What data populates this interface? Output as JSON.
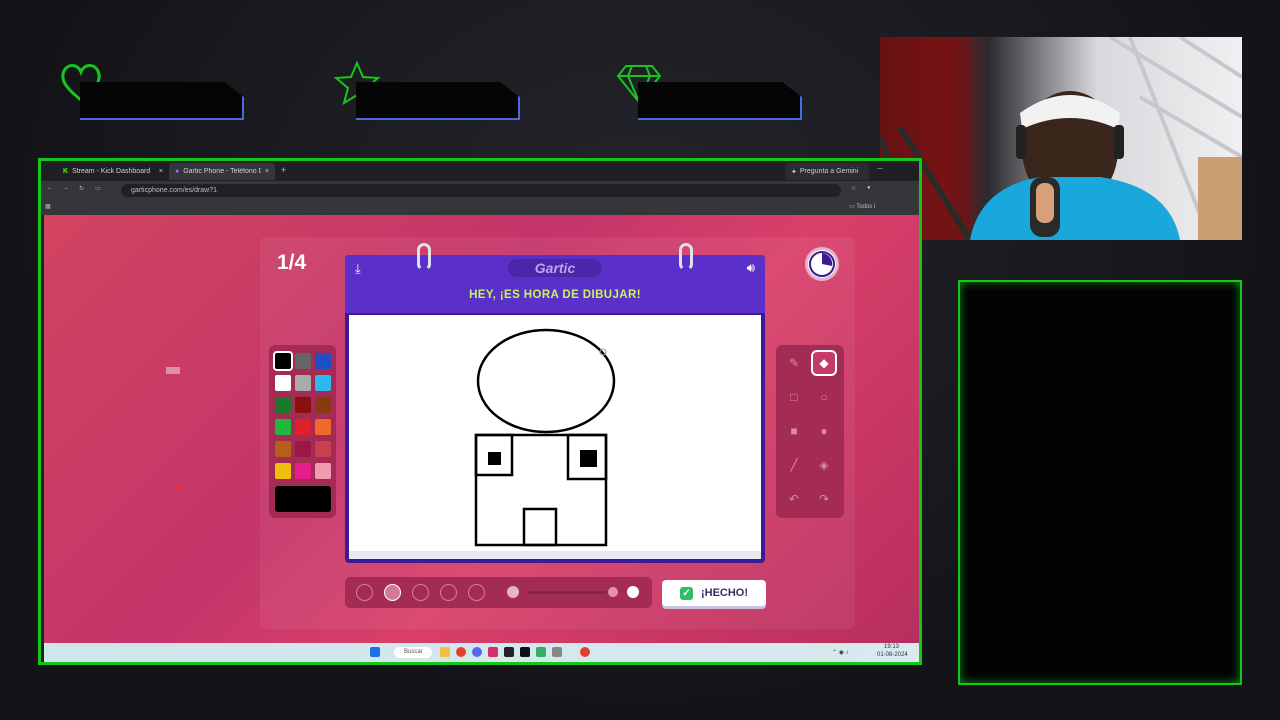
{
  "overlay": {
    "stats": [
      {
        "icon": "heart-icon",
        "color": "#16c61c"
      },
      {
        "icon": "star-icon",
        "color": "#16c61c"
      },
      {
        "icon": "diamond-icon",
        "color": "#16c61c"
      }
    ]
  },
  "browser": {
    "tabs": [
      {
        "label": "Stream - Kick Dashboard",
        "close": "×"
      },
      {
        "label": "Gartic Phone - Teléfono Descon",
        "close": "×"
      }
    ],
    "new_tab": "+",
    "gemini": "Pregunta a Gemini",
    "url": "garticphone.com/es/draw?1",
    "bookmarks_right": "Todos l"
  },
  "game": {
    "round": "1/4",
    "logo": "Gartic",
    "prompt": "HEY, ¡ES HORA DE DIBUJAR!",
    "done_label": "¡HECHO!",
    "palette": [
      "#000000",
      "#666666",
      "#1f4fc8",
      "#ffffff",
      "#aaaaaa",
      "#2bbaf0",
      "#1b7a2a",
      "#8a1010",
      "#8a3a12",
      "#1fb83c",
      "#e0202a",
      "#f0682a",
      "#b4601a",
      "#9a1848",
      "#c84050",
      "#f0c010",
      "#e81c8c",
      "#f09ab0"
    ],
    "current_color": "#000000",
    "tools": [
      "pencil-icon",
      "eraser-icon",
      "rectangle-outline-icon",
      "circle-outline-icon",
      "rectangle-fill-icon",
      "circle-fill-icon",
      "line-icon",
      "bucket-icon",
      "undo-icon",
      "redo-icon"
    ],
    "selected_tool": "eraser-icon"
  },
  "taskbar": {
    "search": "Buscar",
    "time": "19:13",
    "date": "01-08-2024"
  }
}
